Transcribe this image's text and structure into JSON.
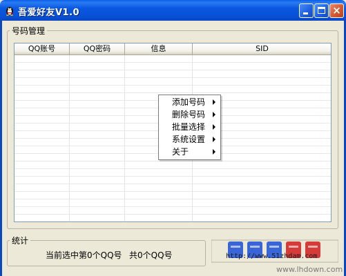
{
  "window": {
    "title": "吾爱好友V1.0"
  },
  "group_account": {
    "label": "号码管理"
  },
  "list": {
    "columns": [
      "QQ账号",
      "QQ密码",
      "信息",
      "SID"
    ]
  },
  "context_menu": {
    "items": [
      "添加号码",
      "删除号码",
      "批量选择",
      "系统设置",
      "关于"
    ]
  },
  "group_stats": {
    "label": "统计",
    "selected_text": "当前选中第0个QQ号",
    "total_text": "共0个QQ号"
  },
  "watermark": {
    "url_text": "http://www.51zhdam.com",
    "domain_text": "www.lhdown.com"
  },
  "colors": {
    "titlebar": "#0a58e0",
    "window_bg": "#ece9d8",
    "watermark_blue": "#1a4fd6",
    "watermark_red": "#d21e1e"
  }
}
